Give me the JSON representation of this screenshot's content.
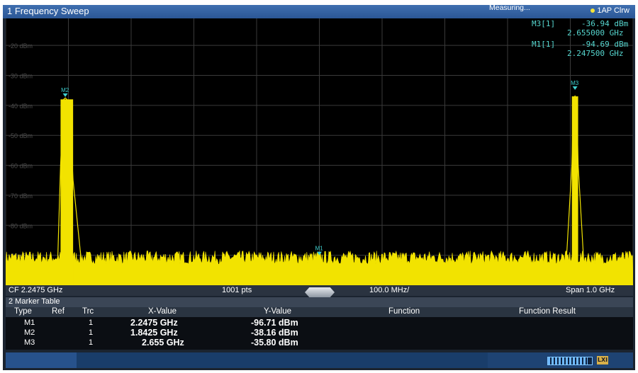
{
  "window": {
    "title": "1 Frequency Sweep",
    "trace_badge": "1AP Clrw"
  },
  "readout": [
    {
      "label": "M3[1]",
      "level": "-36.94 dBm",
      "freq": "2.655000 GHz"
    },
    {
      "label": "M1[1]",
      "level": "-94.69 dBm",
      "freq": "2.247500 GHz"
    }
  ],
  "chart_data": {
    "type": "line",
    "y_ticks": [
      "-20 dBm",
      "-30 dBm",
      "-40 dBm",
      "-50 dBm",
      "-60 dBm",
      "-70 dBm",
      "-80 dBm",
      "-90 dBm"
    ],
    "ylim": [
      -100,
      -11
    ],
    "xlim_ghz": [
      1.7475,
      2.7475
    ],
    "grid": true,
    "noise_floor_dbm": -96,
    "series": [
      {
        "x_ghz": [
          1.7475,
          1.78,
          1.81,
          1.83,
          1.835,
          1.84,
          1.8425,
          1.845,
          1.8475,
          1.85,
          1.855,
          1.87,
          1.9,
          1.95,
          2.0,
          2.05,
          2.07,
          2.1,
          2.15,
          2.2,
          2.2475,
          2.3,
          2.35,
          2.4,
          2.45,
          2.5,
          2.55,
          2.6,
          2.64,
          2.65,
          2.6525,
          2.655,
          2.6575,
          2.66,
          2.67,
          2.7,
          2.7475
        ],
        "y_dbm": [
          -96,
          -95,
          -96,
          -95,
          -60,
          -38,
          -37.5,
          -38,
          -40,
          -45,
          -65,
          -96,
          -95,
          -96,
          -95,
          -96,
          -93,
          -95,
          -96,
          -95,
          -94.7,
          -95,
          -96,
          -95,
          -96,
          -95,
          -96,
          -95,
          -96,
          -60,
          -38,
          -36.9,
          -38,
          -60,
          -96,
          -95,
          -96
        ]
      }
    ],
    "markers": [
      {
        "label": "M1",
        "x_ghz": 2.2475,
        "y_dbm": -96.71
      },
      {
        "label": "M2",
        "x_ghz": 1.8425,
        "y_dbm": -38.16
      },
      {
        "label": "M3",
        "x_ghz": 2.655,
        "y_dbm": -35.8
      }
    ]
  },
  "info": {
    "cf": "CF 2.2475 GHz",
    "pts": "1001 pts",
    "div": "100.0 MHz/",
    "span": "Span 1.0 GHz"
  },
  "marker_table": {
    "title": "2 Marker Table",
    "columns": [
      "Type",
      "Ref",
      "Trc",
      "X-Value",
      "Y-Value",
      "Function",
      "Function Result"
    ],
    "rows": [
      {
        "type": "M1",
        "ref": "",
        "trc": "1",
        "x": "2.2475 GHz",
        "y": "-96.71 dBm"
      },
      {
        "type": "M2",
        "ref": "",
        "trc": "1",
        "x": "1.8425 GHz",
        "y": "-38.16 dBm"
      },
      {
        "type": "M3",
        "ref": "",
        "trc": "1",
        "x": "2.655 GHz",
        "y": "-35.80 dBm"
      }
    ]
  },
  "status": {
    "text": "Measuring...",
    "progress": 0.9,
    "badge": "LXI"
  },
  "colors": {
    "trace": "#f2e300",
    "marker": "#3fd0d0",
    "grid": "#3a3a3a",
    "background": "#000000"
  }
}
